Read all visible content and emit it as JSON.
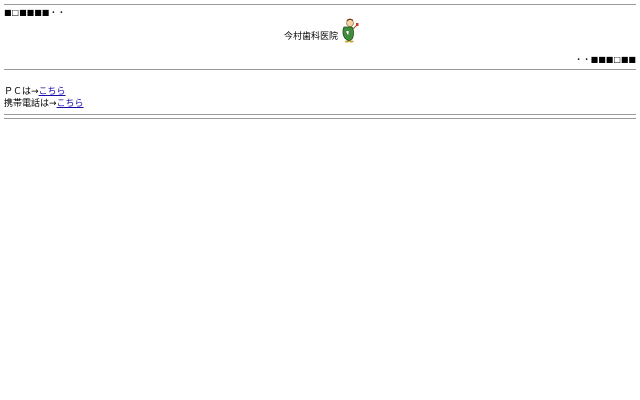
{
  "decorations": {
    "top_left": "■□■■■■・・",
    "right": "・・■■■□■■"
  },
  "header": {
    "clinic_name": "今村歯科医院",
    "logo_icon": "tooth-mascot-icon"
  },
  "links": [
    {
      "prefix": "ＰＣは→",
      "link_text": "こちら"
    },
    {
      "prefix": "携帯電話は→",
      "link_text": "こちら"
    }
  ]
}
